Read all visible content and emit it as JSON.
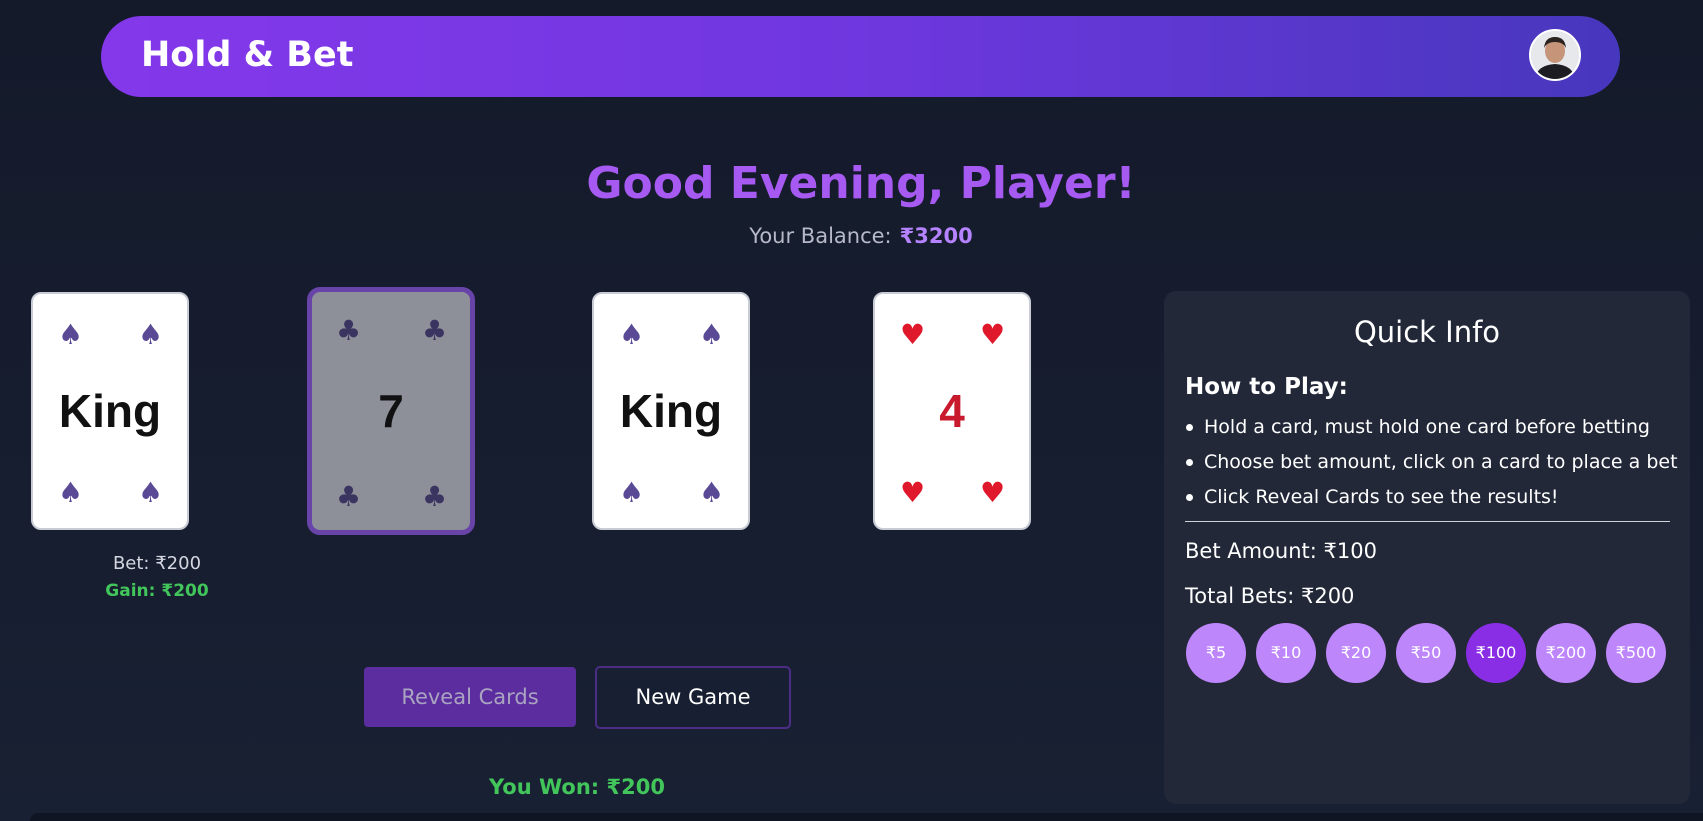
{
  "header": {
    "title": "Hold & Bet",
    "avatar_icon": "user-avatar"
  },
  "greeting": {
    "text": "Good Evening, Player!",
    "balance_label": "Your Balance:",
    "balance_value": "₹3200"
  },
  "cards": [
    {
      "rank": "King",
      "suit": "spade",
      "suit_glyph": "♠",
      "held": false,
      "bet": "Bet: ₹200",
      "gain": "Gain: ₹200"
    },
    {
      "rank": "7",
      "suit": "club",
      "suit_glyph": "♣",
      "held": true
    },
    {
      "rank": "King",
      "suit": "spade",
      "suit_glyph": "♠",
      "held": false
    },
    {
      "rank": "4",
      "suit": "heart",
      "suit_glyph": "♥",
      "held": false
    }
  ],
  "actions": {
    "reveal_label": "Reveal Cards",
    "new_game_label": "New Game"
  },
  "result": {
    "text": "You Won: ₹200"
  },
  "quick_info": {
    "title": "Quick Info",
    "how_to_play_title": "How to Play:",
    "rules": [
      "Hold a card, must hold one card before betting",
      "Choose bet amount, click on a card to place a bet",
      "Click Reveal Cards to see the results!"
    ],
    "bet_amount": "Bet Amount: ₹100",
    "total_bets": "Total Bets: ₹200",
    "chips": [
      {
        "label": "₹5",
        "selected": false
      },
      {
        "label": "₹10",
        "selected": false
      },
      {
        "label": "₹20",
        "selected": false
      },
      {
        "label": "₹50",
        "selected": false
      },
      {
        "label": "₹100",
        "selected": true
      },
      {
        "label": "₹200",
        "selected": false
      },
      {
        "label": "₹500",
        "selected": false
      }
    ]
  },
  "colors": {
    "background": "#151b2b",
    "header_start": "#8438ea",
    "header_end": "#4737bd",
    "accent_purple": "#a65af2",
    "gain_green": "#42c55a",
    "chip": "#be86fb",
    "chip_selected": "#8a2ee6",
    "panel": "#222838"
  }
}
